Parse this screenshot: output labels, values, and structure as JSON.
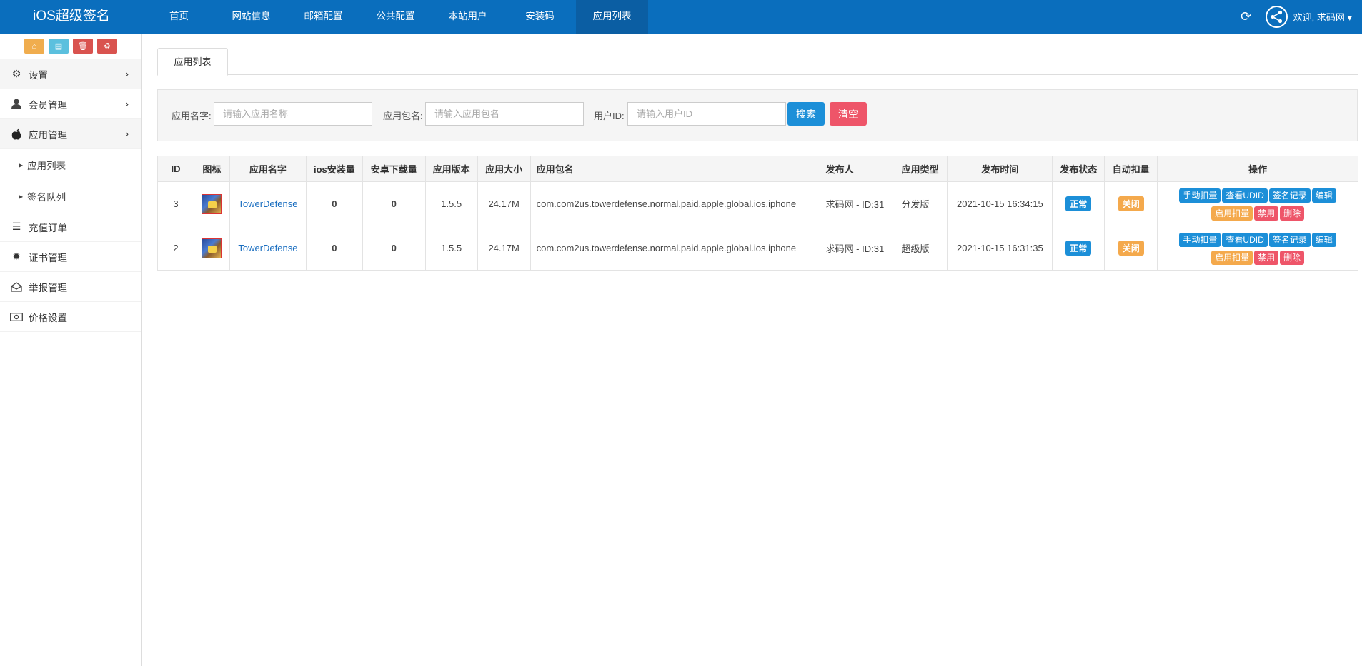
{
  "brand": "iOS超级签名",
  "nav": [
    "首页",
    "网站信息",
    "邮箱配置",
    "公共配置",
    "本站用户",
    "安装码",
    "应用列表"
  ],
  "nav_active": 6,
  "user_menu": "欢迎, 求码网 ▾",
  "icons": {
    "refresh": "refresh-icon",
    "avatar": "share-icon"
  },
  "shortcuts": [
    "home-icon",
    "file-icon",
    "trash-icon",
    "recycle-icon"
  ],
  "sidebar": {
    "settings": "设置",
    "members": "会员管理",
    "apps": "应用管理",
    "app_list": "应用列表",
    "sign_queue": "签名队列",
    "orders": "充值订单",
    "certs": "证书管理",
    "reports": "举报管理",
    "prices": "价格设置"
  },
  "tab_label": "应用列表",
  "search": {
    "name_label": "应用名字:",
    "name_placeholder": "请输入应用名称",
    "pkg_label": "应用包名:",
    "pkg_placeholder": "请输入应用包名",
    "uid_label": "用户ID:",
    "uid_placeholder": "请输入用户ID",
    "search_btn": "搜索",
    "clear_btn": "清空"
  },
  "table": {
    "headers": [
      "ID",
      "图标",
      "应用名字",
      "ios安装量",
      "安卓下载量",
      "应用版本",
      "应用大小",
      "应用包名",
      "发布人",
      "应用类型",
      "发布时间",
      "发布状态",
      "自动扣量",
      "操作"
    ],
    "rows": [
      {
        "id": "3",
        "name": "TowerDefense",
        "ios": "0",
        "android": "0",
        "version": "1.5.5",
        "size": "24.17M",
        "bundle": "com.com2us.towerdefense.normal.paid.apple.global.ios.iphone",
        "publisher": "求码网 - ID:31",
        "type": "分发版",
        "time": "2021-10-15 16:34:15",
        "status": "正常",
        "auto": "关闭"
      },
      {
        "id": "2",
        "name": "TowerDefense",
        "ios": "0",
        "android": "0",
        "version": "1.5.5",
        "size": "24.17M",
        "bundle": "com.com2us.towerdefense.normal.paid.apple.global.ios.iphone",
        "publisher": "求码网 - ID:31",
        "type": "超级版",
        "time": "2021-10-15 16:31:35",
        "status": "正常",
        "auto": "关闭"
      }
    ],
    "ops": {
      "manual": "手动扣量",
      "udid": "查看UDID",
      "sign_log": "签名记录",
      "edit": "编辑",
      "enable": "启用扣量",
      "ban": "禁用",
      "delete": "删除"
    }
  },
  "colors": {
    "topbar": "#0a6ebd",
    "primary": "#1c8fd8",
    "danger": "#ee5569",
    "warning": "#f4a94c"
  }
}
